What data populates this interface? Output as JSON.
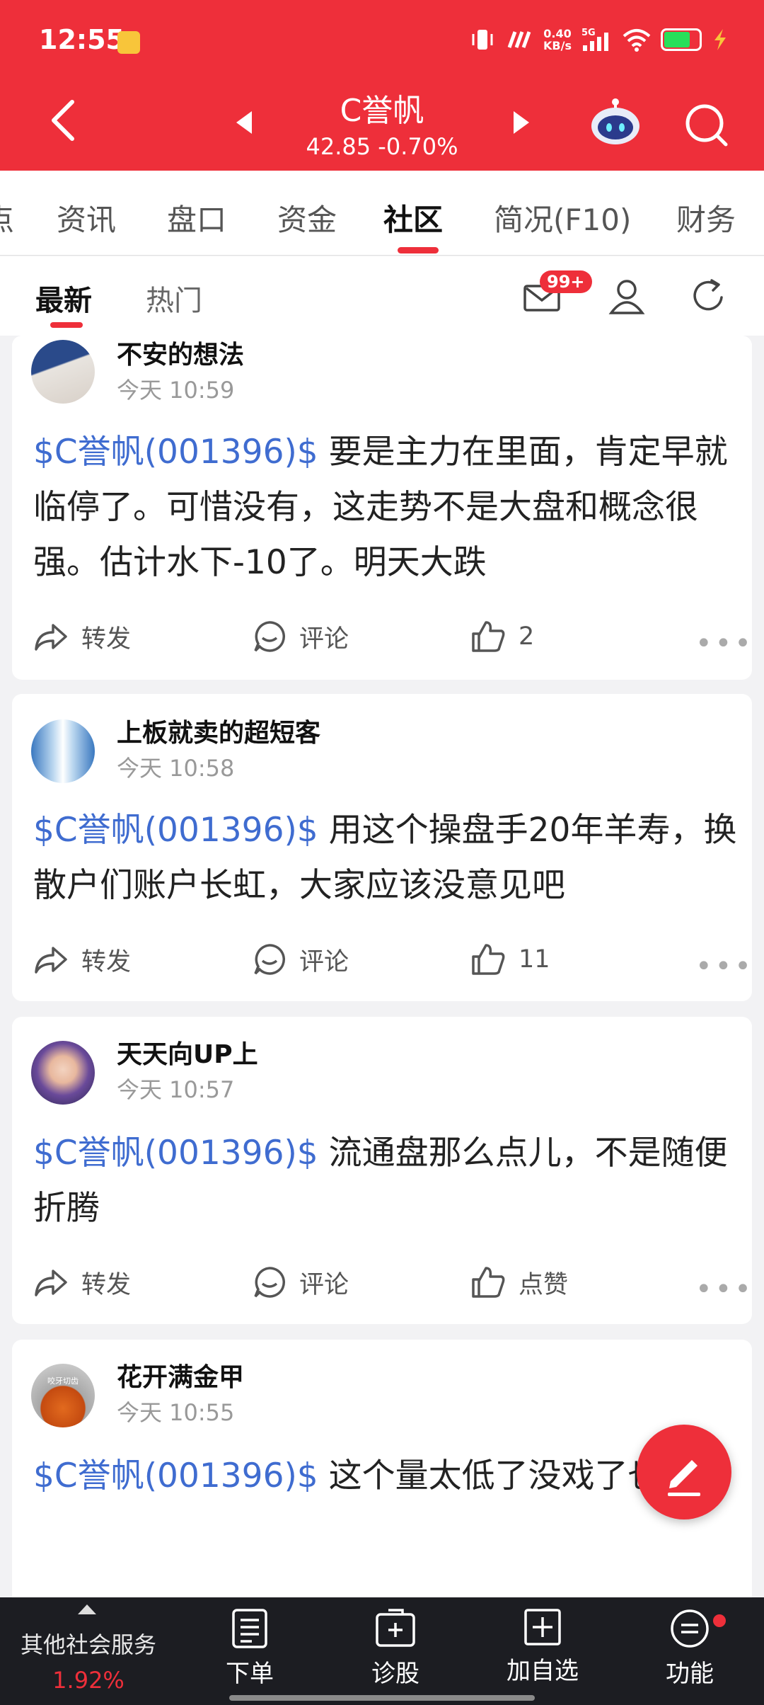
{
  "status_bar": {
    "time": "12:55",
    "net_speed_value": "0.40",
    "net_speed_unit": "KB/s",
    "network": "5G",
    "battery_color": "#27e05a"
  },
  "header": {
    "stock_name": "C誉帆",
    "price": "42.85",
    "change": "-0.70%",
    "accent": "#ee2f3a"
  },
  "tabs": [
    {
      "label": "点"
    },
    {
      "label": "资讯"
    },
    {
      "label": "盘口"
    },
    {
      "label": "资金"
    },
    {
      "label": "社区",
      "active": true
    },
    {
      "label": "简况(F10)"
    },
    {
      "label": "财务"
    }
  ],
  "subtabs": {
    "latest": "最新",
    "hot": "热门",
    "mail_badge": "99+"
  },
  "posts": [
    {
      "user": "不安的想法",
      "time": "今天 10:59",
      "tag": "$C誉帆(001396)$",
      "text": " 要是主力在里面，肯定早就临停了。可惜没有，这走势不是大盘和概念很强。估计水下-10了。明天大跌",
      "repost": "转发",
      "comment": "评论",
      "like": "2"
    },
    {
      "user": "上板就卖的超短客",
      "time": "今天 10:58",
      "tag": "$C誉帆(001396)$",
      "text": " 用这个操盘手20年羊寿，换散户们账户长虹，大家应该没意见吧",
      "repost": "转发",
      "comment": "评论",
      "like": "11"
    },
    {
      "user": "天天向UP上",
      "time": "今天 10:57",
      "tag": "$C誉帆(001396)$",
      "text": " 流通盘那么点儿，不是随便折腾",
      "repost": "转发",
      "comment": "评论",
      "like": "点赞"
    },
    {
      "user": "花开满金甲",
      "time": "今天 10:55",
      "tag": "$C誉帆(001396)$",
      "text": " 这个量太低了没戏了也gg",
      "avatar_text": "咬牙切齿"
    }
  ],
  "bottom_bar": {
    "other_services": "其他社会服务",
    "other_pct": "1.92%",
    "items": [
      {
        "label": "下单",
        "icon": "order-icon"
      },
      {
        "label": "诊股",
        "icon": "diagnose-icon"
      },
      {
        "label": "加自选",
        "icon": "add-watchlist-icon"
      },
      {
        "label": "功能",
        "icon": "menu-icon"
      }
    ]
  }
}
